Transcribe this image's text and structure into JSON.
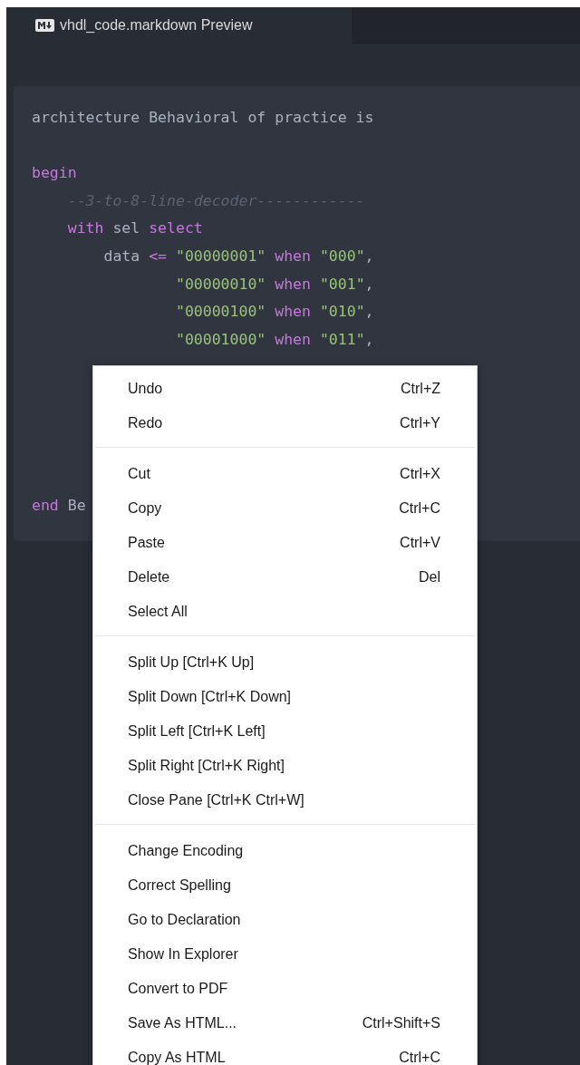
{
  "tab": {
    "title": "vhdl_code.markdown Preview",
    "selected": true
  },
  "code_lines": [
    {
      "kind": "code",
      "tokens": [
        {
          "text": "architecture Behavioral of practice is",
          "kind": "plain"
        }
      ]
    },
    {
      "kind": "blank"
    },
    {
      "kind": "code",
      "tokens": [
        {
          "text": "begin",
          "kind": "keyword"
        }
      ]
    },
    {
      "kind": "code",
      "tokens": [
        {
          "text": "    --3-to-8-line-decoder------------",
          "kind": "comment"
        }
      ]
    },
    {
      "kind": "code",
      "tokens": [
        {
          "text": "    with",
          "kind": "keyword"
        },
        {
          "text": " sel ",
          "kind": "plain"
        },
        {
          "text": "select",
          "kind": "keyword"
        }
      ]
    },
    {
      "kind": "code",
      "tokens": [
        {
          "text": "        data ",
          "kind": "plain"
        },
        {
          "text": "<=",
          "kind": "keyword"
        },
        {
          "text": " \"00000001\"",
          "kind": "string"
        },
        {
          "text": " when ",
          "kind": "keyword"
        },
        {
          "text": "\"000\"",
          "kind": "string"
        },
        {
          "text": ",",
          "kind": "plain"
        }
      ]
    },
    {
      "kind": "code",
      "tokens": [
        {
          "text": "                \"00000010\"",
          "kind": "string"
        },
        {
          "text": " when ",
          "kind": "keyword"
        },
        {
          "text": "\"001\"",
          "kind": "string"
        },
        {
          "text": ",",
          "kind": "plain"
        }
      ]
    },
    {
      "kind": "code",
      "tokens": [
        {
          "text": "                \"00000100\"",
          "kind": "string"
        },
        {
          "text": " when ",
          "kind": "keyword"
        },
        {
          "text": "\"010\"",
          "kind": "string"
        },
        {
          "text": ",",
          "kind": "plain"
        }
      ]
    },
    {
      "kind": "code",
      "tokens": [
        {
          "text": "                \"00001000\"",
          "kind": "string"
        },
        {
          "text": " when ",
          "kind": "keyword"
        },
        {
          "text": "\"011\"",
          "kind": "string"
        },
        {
          "text": ",",
          "kind": "plain"
        }
      ]
    },
    {
      "kind": "blank"
    },
    {
      "kind": "blank"
    },
    {
      "kind": "blank"
    },
    {
      "kind": "blank"
    },
    {
      "kind": "blank"
    },
    {
      "kind": "code",
      "tokens": [
        {
          "text": "end",
          "kind": "keyword"
        },
        {
          "text": " Be",
          "kind": "plain"
        }
      ]
    }
  ],
  "context_menu": [
    {
      "kind": "item",
      "label": "Undo",
      "shortcut": "Ctrl+Z"
    },
    {
      "kind": "item",
      "label": "Redo",
      "shortcut": "Ctrl+Y"
    },
    {
      "kind": "separator"
    },
    {
      "kind": "item",
      "label": "Cut",
      "shortcut": "Ctrl+X"
    },
    {
      "kind": "item",
      "label": "Copy",
      "shortcut": "Ctrl+C"
    },
    {
      "kind": "item",
      "label": "Paste",
      "shortcut": "Ctrl+V"
    },
    {
      "kind": "item",
      "label": "Delete",
      "shortcut": "Del"
    },
    {
      "kind": "item",
      "label": "Select All"
    },
    {
      "kind": "separator"
    },
    {
      "kind": "item",
      "label": "Split Up [Ctrl+K Up]"
    },
    {
      "kind": "item",
      "label": "Split Down [Ctrl+K Down]"
    },
    {
      "kind": "item",
      "label": "Split Left [Ctrl+K Left]"
    },
    {
      "kind": "item",
      "label": "Split Right [Ctrl+K Right]"
    },
    {
      "kind": "item",
      "label": "Close Pane [Ctrl+K Ctrl+W]"
    },
    {
      "kind": "separator"
    },
    {
      "kind": "item",
      "label": "Change Encoding"
    },
    {
      "kind": "item",
      "label": "Correct Spelling"
    },
    {
      "kind": "item",
      "label": "Go to Declaration"
    },
    {
      "kind": "item",
      "label": "Show In Explorer"
    },
    {
      "kind": "item",
      "label": "Convert to PDF"
    },
    {
      "kind": "item",
      "label": "Save As HTML...",
      "shortcut": "Ctrl+Shift+S"
    },
    {
      "kind": "item",
      "label": "Copy As HTML",
      "shortcut": "Ctrl+C"
    }
  ]
}
